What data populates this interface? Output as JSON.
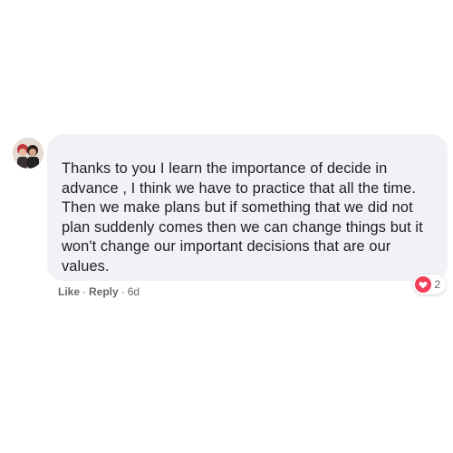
{
  "comment": {
    "avatar_icon": "user-avatar-photo",
    "text": "Thanks to you I learn the importance of decide in advance , I think we have to practice that all the time. Then we make plans but if something that we did not plan suddenly comes then we can change things but it won't change our important decisions that are our values.",
    "reactions": {
      "icon": "love-reaction-icon",
      "color": "#f33e58",
      "count": "2"
    },
    "actions": {
      "like_label": "Like",
      "reply_label": "Reply",
      "separator": "·",
      "timestamp": "6d"
    }
  }
}
